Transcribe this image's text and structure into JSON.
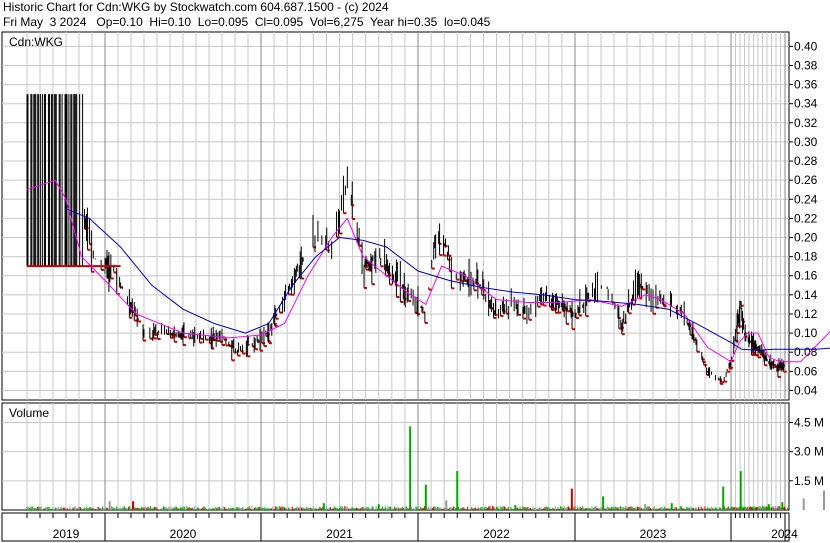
{
  "header": {
    "line1": "Historic Chart for Cdn:WKG by Stockwatch.com 604.687.1500 - (c) 2024",
    "line2": "Fri May  3 2024   Op=0.10  Hi=0.10  Lo=0.095  Cl=0.095  Vol=6,275  Year hi=0.35  lo=0.045"
  },
  "chart_data": [
    {
      "type": "line",
      "title": "Cdn:WKG",
      "x_axis": {
        "ticks": [
          "2019",
          "2020",
          "2021",
          "2022",
          "2023",
          "2024"
        ]
      },
      "y_axis": {
        "ylim": [
          0.03,
          0.415
        ],
        "ticks": [
          "0.40",
          "0.38",
          "0.36",
          "0.34",
          "0.32",
          "0.30",
          "0.28",
          "0.26",
          "0.24",
          "0.22",
          "0.20",
          "0.18",
          "0.16",
          "0.14",
          "0.12",
          "0.10",
          "0.08",
          "0.06",
          "0.04"
        ]
      },
      "grid": true,
      "colors": {
        "price_bar": "#000000",
        "close_dash": "#cc0000",
        "ma_short": "#ff00ff",
        "ma_long": "#0000cc"
      },
      "series": [
        {
          "name": "price",
          "points": [
            [
              2018.5,
              0.17
            ],
            [
              2018.7,
              0.17
            ],
            [
              2018.78,
              0.23
            ],
            [
              2018.85,
              0.23
            ],
            [
              2018.95,
              0.17
            ],
            [
              2019.05,
              0.17
            ],
            [
              2019.25,
              0.1
            ],
            [
              2019.4,
              0.1
            ],
            [
              2019.6,
              0.095
            ],
            [
              2019.75,
              0.095
            ],
            [
              2019.85,
              0.08
            ],
            [
              2019.95,
              0.09
            ],
            [
              2020.05,
              0.1
            ],
            [
              2020.15,
              0.14
            ],
            [
              2020.25,
              0.17
            ],
            [
              2020.35,
              0.2
            ],
            [
              2020.45,
              0.19
            ],
            [
              2020.55,
              0.26
            ],
            [
              2020.65,
              0.17
            ],
            [
              2020.75,
              0.18
            ],
            [
              2020.85,
              0.16
            ],
            [
              2020.95,
              0.14
            ],
            [
              2021.05,
              0.12
            ],
            [
              2021.1,
              0.19
            ],
            [
              2021.15,
              0.2
            ],
            [
              2021.25,
              0.16
            ],
            [
              2021.4,
              0.15
            ],
            [
              2021.5,
              0.12
            ],
            [
              2021.6,
              0.13
            ],
            [
              2021.7,
              0.12
            ],
            [
              2021.8,
              0.14
            ],
            [
              2021.9,
              0.13
            ],
            [
              2022.0,
              0.12
            ],
            [
              2022.1,
              0.14
            ],
            [
              2022.2,
              0.15
            ],
            [
              2022.3,
              0.11
            ],
            [
              2022.4,
              0.15
            ],
            [
              2022.5,
              0.14
            ],
            [
              2022.6,
              0.13
            ],
            [
              2022.7,
              0.12
            ],
            [
              2022.85,
              0.06
            ],
            [
              2022.95,
              0.05
            ],
            [
              2023.0,
              0.07
            ],
            [
              2023.1,
              0.1
            ],
            [
              2023.18,
              0.13
            ],
            [
              2023.25,
              0.1
            ],
            [
              2023.4,
              0.09
            ],
            [
              2023.55,
              0.08
            ],
            [
              2023.7,
              0.07
            ],
            [
              2023.85,
              0.065
            ],
            [
              2023.95,
              0.065
            ],
            [
              2024.1,
              0.07
            ],
            [
              2024.2,
              0.07
            ],
            [
              2024.25,
              0.13
            ],
            [
              2024.3,
              0.12
            ],
            [
              2024.34,
              0.1
            ]
          ]
        },
        {
          "name": "short moving average",
          "points": [
            [
              2018.5,
              0.25
            ],
            [
              2018.68,
              0.26
            ],
            [
              2018.75,
              0.24
            ],
            [
              2018.85,
              0.18
            ],
            [
              2019.0,
              0.155
            ],
            [
              2019.2,
              0.12
            ],
            [
              2019.5,
              0.1
            ],
            [
              2019.8,
              0.095
            ],
            [
              2020.0,
              0.098
            ],
            [
              2020.15,
              0.11
            ],
            [
              2020.3,
              0.16
            ],
            [
              2020.45,
              0.2
            ],
            [
              2020.55,
              0.22
            ],
            [
              2020.65,
              0.18
            ],
            [
              2020.8,
              0.16
            ],
            [
              2020.95,
              0.14
            ],
            [
              2021.05,
              0.13
            ],
            [
              2021.15,
              0.17
            ],
            [
              2021.3,
              0.16
            ],
            [
              2021.5,
              0.135
            ],
            [
              2021.7,
              0.132
            ],
            [
              2021.9,
              0.132
            ],
            [
              2022.1,
              0.135
            ],
            [
              2022.3,
              0.128
            ],
            [
              2022.45,
              0.14
            ],
            [
              2022.55,
              0.135
            ],
            [
              2022.7,
              0.12
            ],
            [
              2022.85,
              0.085
            ],
            [
              2023.0,
              0.07
            ],
            [
              2023.15,
              0.09
            ],
            [
              2023.3,
              0.1
            ],
            [
              2023.5,
              0.1
            ],
            [
              2023.7,
              0.075
            ],
            [
              2023.9,
              0.07
            ],
            [
              2024.1,
              0.07
            ],
            [
              2024.22,
              0.09
            ],
            [
              2024.34,
              0.11
            ]
          ]
        },
        {
          "name": "long moving average",
          "points": [
            [
              2018.75,
              0.23
            ],
            [
              2018.9,
              0.22
            ],
            [
              2019.1,
              0.19
            ],
            [
              2019.3,
              0.15
            ],
            [
              2019.5,
              0.125
            ],
            [
              2019.7,
              0.11
            ],
            [
              2019.9,
              0.1
            ],
            [
              2020.05,
              0.11
            ],
            [
              2020.2,
              0.15
            ],
            [
              2020.35,
              0.18
            ],
            [
              2020.5,
              0.2
            ],
            [
              2020.65,
              0.197
            ],
            [
              2020.8,
              0.19
            ],
            [
              2021.0,
              0.165
            ],
            [
              2021.2,
              0.155
            ],
            [
              2021.4,
              0.148
            ],
            [
              2021.6,
              0.143
            ],
            [
              2021.8,
              0.14
            ],
            [
              2022.0,
              0.135
            ],
            [
              2022.2,
              0.133
            ],
            [
              2022.4,
              0.13
            ],
            [
              2022.6,
              0.125
            ],
            [
              2022.8,
              0.108
            ],
            [
              2023.0,
              0.09
            ],
            [
              2023.2,
              0.083
            ],
            [
              2023.5,
              0.082
            ],
            [
              2023.8,
              0.083
            ],
            [
              2024.0,
              0.083
            ],
            [
              2024.2,
              0.083
            ],
            [
              2024.34,
              0.085
            ]
          ]
        }
      ]
    },
    {
      "type": "bar",
      "title": "Volume",
      "y_axis": {
        "ylim": [
          0,
          5.5
        ],
        "unit": "M",
        "ticks": [
          "4.5 M",
          "3.0 M",
          "1.5 M"
        ]
      },
      "bars": [
        [
          2020.95,
          4.3,
          "#00aa00"
        ],
        [
          2021.25,
          2.0,
          "#00aa00"
        ],
        [
          2021.05,
          1.3,
          "#00aa00"
        ],
        [
          2021.98,
          1.1,
          "#cc0000"
        ],
        [
          2022.18,
          0.7,
          "#00aa00"
        ],
        [
          2022.95,
          1.2,
          "#00aa00"
        ],
        [
          2023.18,
          2.0,
          "#00aa00"
        ],
        [
          2022.62,
          0.35,
          "#00aa00"
        ],
        [
          2021.18,
          0.5,
          "#999999"
        ],
        [
          2020.4,
          0.35,
          "#00aa00"
        ],
        [
          2019.18,
          0.45,
          "#cc0000"
        ],
        [
          2019.03,
          0.45,
          "#999999"
        ],
        [
          2024.25,
          1.0,
          "#999999"
        ],
        [
          2024.12,
          0.6,
          "#999999"
        ],
        [
          2023.95,
          0.4,
          "#00aa00"
        ],
        [
          2023.7,
          0.3,
          "#00aa00"
        ],
        [
          2022.45,
          0.3,
          "#999999"
        ],
        [
          2020.75,
          0.3,
          "#00aa00"
        ],
        [
          2021.62,
          0.25,
          "#00aa00"
        ],
        [
          2024.3,
          0.3,
          "#00aa00"
        ]
      ]
    }
  ]
}
